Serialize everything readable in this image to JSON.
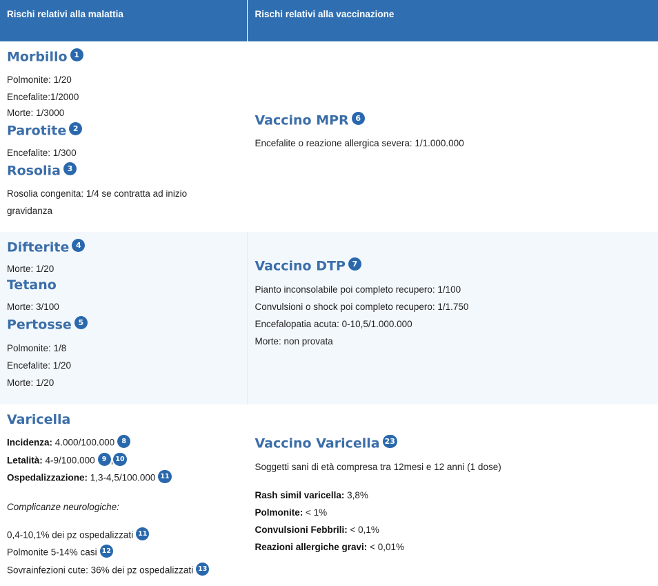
{
  "header": {
    "col1": "Rischi relativi alla malattia",
    "col2": "Rischi relativi alla vaccinazione"
  },
  "rows": [
    {
      "diseases": [
        {
          "name": "Morbillo",
          "ref": "1",
          "items": [
            "Polmonite: 1/20",
            "Encefalite:1/2000",
            "Morte: 1/3000"
          ]
        },
        {
          "name": "Parotite",
          "ref": "2",
          "items": [
            "Encefalite: 1/300"
          ]
        },
        {
          "name": "Rosolia",
          "ref": "3",
          "items": [
            "Rosolia congenita: 1/4 se contratta ad inizio",
            "gravidanza"
          ]
        }
      ],
      "vaccine": {
        "name": "Vaccino MPR",
        "ref": "6",
        "items": [
          "Encefalite o reazione allergica severa: 1/1.000.000"
        ]
      }
    },
    {
      "diseases": [
        {
          "name": "Difterite",
          "ref": "4",
          "items": [
            "Morte: 1/20"
          ]
        },
        {
          "name": "Tetano",
          "ref": "",
          "items": [
            "Morte: 3/100"
          ]
        },
        {
          "name": "Pertosse",
          "ref": "5",
          "items": [
            "Polmonite: 1/8",
            "Encefalite: 1/20",
            "Morte: 1/20"
          ]
        }
      ],
      "vaccine": {
        "name": "Vaccino DTP",
        "ref": "7",
        "items": [
          "Pianto inconsolabile poi completo recupero: 1/100",
          "Convulsioni o shock poi completo recupero: 1/1.750",
          "Encefalopatia acuta: 0-10,5/1.000.000",
          "Morte: non provata"
        ]
      }
    },
    {
      "disease": {
        "name": "Varicella",
        "incidence_label": "Incidenza:",
        "incidence_value": "4.000/100.000",
        "incidence_ref": "8",
        "lethality_label": "Letalità:",
        "lethality_value": "4-9/100.000",
        "lethality_ref_a": "9",
        "lethality_sep": ",",
        "lethality_ref_b": "10",
        "hosp_label": "Ospedalizzazione:",
        "hosp_value": "1,3-4,5/100.000",
        "hosp_ref": "11",
        "neuro_heading": "Complicanze neurologiche:",
        "neuro_1": "0,4-10,1% dei pz ospedalizzati",
        "neuro_1_ref": "11",
        "neuro_2": "Polmonite 5-14% casi",
        "neuro_2_ref": "12",
        "neuro_3": "Sovrainfezioni cute: 36% dei pz ospedalizzati",
        "neuro_3_ref": "13"
      },
      "vaccine": {
        "name": "Vaccino Varicella",
        "ref": "23",
        "intro": "Soggetti sani di età compresa tra 12mesi e 12 anni (1 dose)",
        "effects": [
          {
            "label": "Rash simil varicella:",
            "value": " 3,8%"
          },
          {
            "label": "Polmonite:",
            "value": " < 1%"
          },
          {
            "label": "Convulsioni Febbrili:",
            "value": " < 0,1%"
          },
          {
            "label": "Reazioni allergiche gravi:",
            "value": " < 0,01%"
          }
        ]
      }
    }
  ],
  "colors": {
    "header_bg": "#2f6fb1",
    "title": "#3b6ea8",
    "badge": "#2a68ad",
    "alt_row": "#f3f8fd"
  }
}
